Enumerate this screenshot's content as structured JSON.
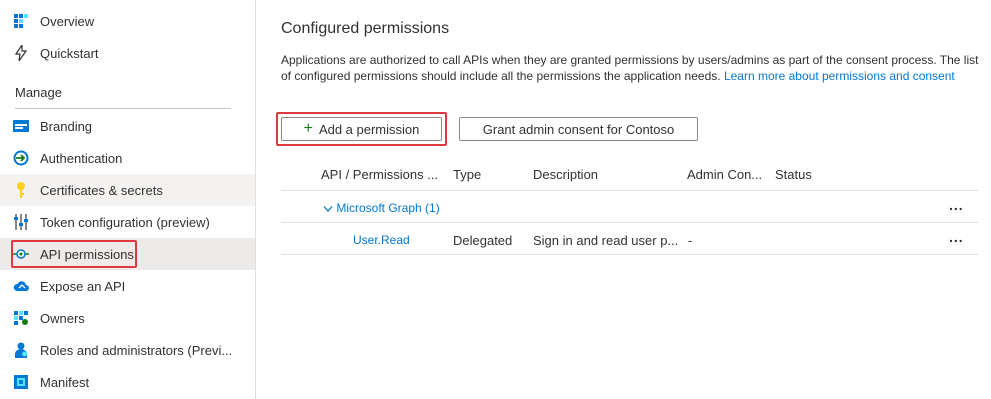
{
  "sidebar": {
    "items": [
      {
        "label": "Overview",
        "icon": "overview-icon"
      },
      {
        "label": "Quickstart",
        "icon": "quickstart-icon"
      },
      {
        "label": "Branding",
        "icon": "branding-icon"
      },
      {
        "label": "Authentication",
        "icon": "authentication-icon"
      },
      {
        "label": "Certificates & secrets",
        "icon": "key-icon"
      },
      {
        "label": "Token configuration (preview)",
        "icon": "token-config-icon"
      },
      {
        "label": "API permissions",
        "icon": "api-permissions-icon"
      },
      {
        "label": "Expose an API",
        "icon": "cloud-icon"
      },
      {
        "label": "Owners",
        "icon": "owners-icon"
      },
      {
        "label": "Roles and administrators (Previ...",
        "icon": "roles-icon"
      },
      {
        "label": "Manifest",
        "icon": "manifest-icon"
      }
    ],
    "section_label": "Manage",
    "selected": "API permissions"
  },
  "main": {
    "title": "Configured permissions",
    "description": "Applications are authorized to call APIs when they are granted permissions by users/admins as part of the consent process. The list of configured permissions should include all the permissions the application needs.",
    "learn_more": "Learn more about permissions and consent",
    "add_permission_label": "Add a permission",
    "grant_consent_label": "Grant admin consent for Contoso",
    "table": {
      "headers": [
        "API / Permissions ...",
        "Type",
        "Description",
        "Admin Con...",
        "Status"
      ],
      "group": {
        "label": "Microsoft Graph (1)"
      },
      "rows": [
        {
          "name": "User.Read",
          "type": "Delegated",
          "description": "Sign in and read user p...",
          "admin_consent": "-",
          "status": ""
        }
      ],
      "more_label": "..."
    }
  },
  "colors": {
    "accent": "#0078d4",
    "highlight": "#e0383e",
    "add_icon": "#107c10"
  }
}
